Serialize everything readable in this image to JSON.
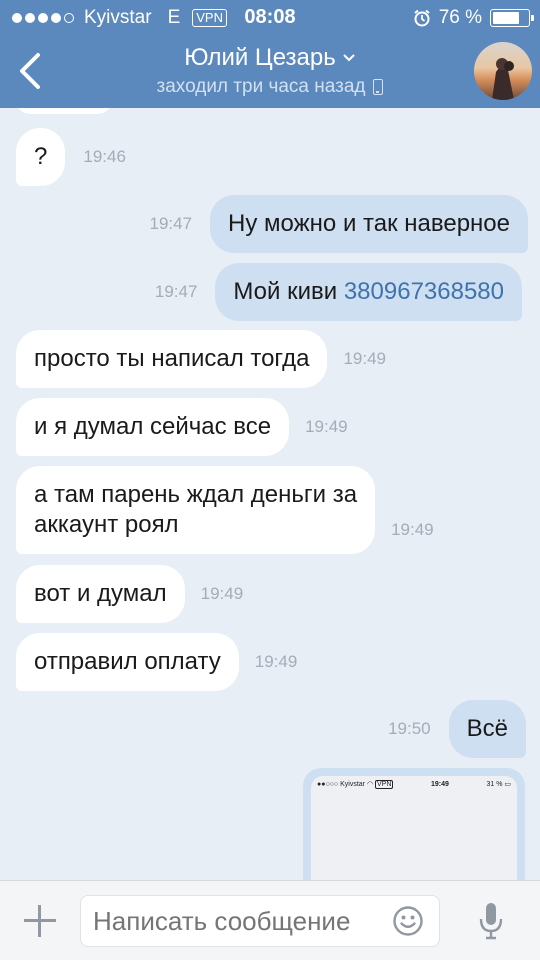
{
  "status_bar": {
    "carrier": "Kyivstar",
    "network": "E",
    "vpn": "VPN",
    "time": "08:08",
    "battery_text": "76 %",
    "battery_level": 0.76
  },
  "header": {
    "name": "Юлий Цезарь",
    "last_seen": "заходил три часа назад"
  },
  "messages": [
    {
      "text": "?",
      "time": "19:46",
      "dir": "in"
    },
    {
      "text": "Ну можно и так наверное",
      "time": "19:47",
      "dir": "out"
    },
    {
      "text": "Мой киви ",
      "link": "380967368580",
      "time": "19:47",
      "dir": "out"
    },
    {
      "text": "просто ты написал тогда",
      "time": "19:49",
      "dir": "in"
    },
    {
      "text": "и я думал сейчас все",
      "time": "19:49",
      "dir": "in"
    },
    {
      "line1": "а там парень ждал деньги за",
      "line2": "аккаунт роял",
      "time": "19:49",
      "dir": "in"
    },
    {
      "text": "вот и думал",
      "time": "19:49",
      "dir": "in"
    },
    {
      "text": "отправил оплату",
      "time": "19:49",
      "dir": "in"
    },
    {
      "text": "Всё",
      "time": "19:50",
      "dir": "out"
    }
  ],
  "photo_preview": {
    "carrier": "Kyivstar",
    "vpn": "VPN",
    "time": "19:49",
    "battery": "31 %"
  },
  "composer": {
    "placeholder": "Написать сообщение"
  },
  "colors": {
    "header_bg": "#5b88bd",
    "chat_bg": "#e8eef5",
    "incoming_bubble": "#ffffff",
    "outgoing_bubble": "#cfdff2",
    "link": "#3e73ad"
  }
}
